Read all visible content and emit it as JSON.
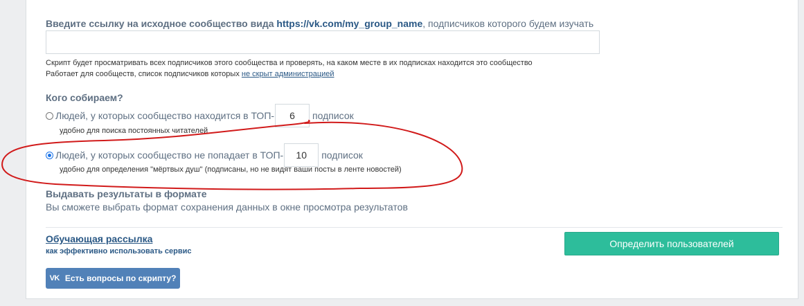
{
  "source": {
    "label_prefix": "Введите ссылку на исходное сообщество вида",
    "label_link": "https://vk.com/my_group_name",
    "label_suffix": ", подписчиков которого будем изучать",
    "input_value": "",
    "hint_line1": "Скрипт будет просматривать всех подписчиков этого сообщества и проверять, на каком месте в их подписках находится это сообщество",
    "hint_line2_prefix": "Работает для сообществ, список подписчиков которых",
    "hint_line2_link": "не скрыт администрацией"
  },
  "collect": {
    "heading": "Кого собираем?",
    "option1": {
      "text_before": "Людей, у которых сообщество находится в ТОП-",
      "value": "6",
      "text_after": "подписок",
      "hint": "удобно для поиска постоянных читателей",
      "checked": false
    },
    "option2": {
      "text_before": "Людей, у которых сообщество не попадает в ТОП-",
      "value": "10",
      "text_after": "подписок",
      "hint": "удобно для определения \"мёртвых душ\" (подписаны, но не видят ваши посты в ленте новостей)",
      "checked": true
    }
  },
  "format": {
    "heading": "Выдавать результаты в формате",
    "text": "Вы сможете выбрать формат сохранения данных в окне просмотра результатов"
  },
  "footer": {
    "newsletter_link": "Обучающая рассылка",
    "newsletter_sub": "как эффективно использовать сервис",
    "submit_button": "Определить пользователей",
    "vk_logo": "VK",
    "questions_button": "Есть вопросы по скрипту?"
  },
  "colors": {
    "accent_link": "#2a5885",
    "button_green": "#2dbd9b",
    "button_vk": "#5181b8",
    "annotation_red": "#d11a1a"
  }
}
